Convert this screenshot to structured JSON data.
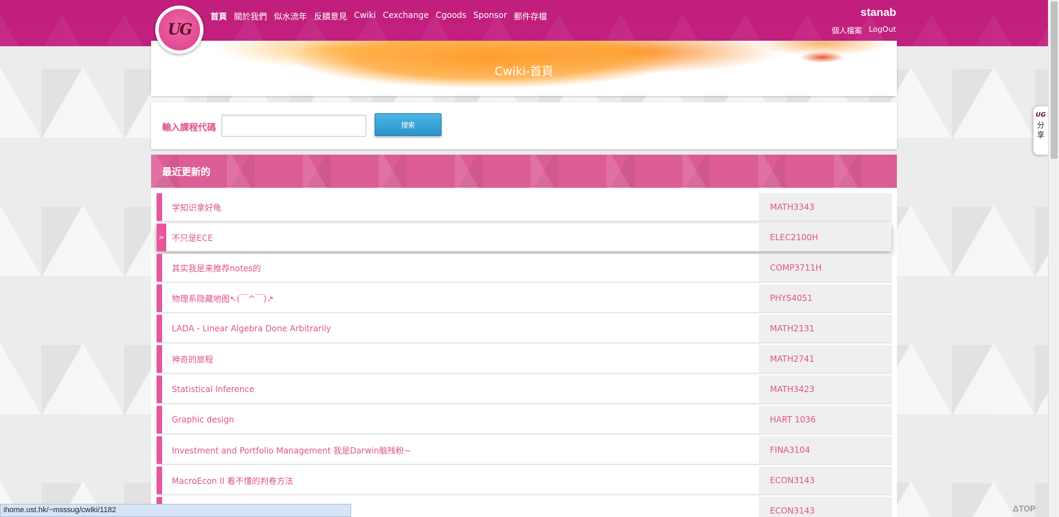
{
  "nav": {
    "items": [
      {
        "label": "首頁",
        "active": true
      },
      {
        "label": "關於我們"
      },
      {
        "label": "似水流年"
      },
      {
        "label": "反饋意見"
      },
      {
        "label": "Cwiki"
      },
      {
        "label": "Cexchange"
      },
      {
        "label": "Cgoods"
      },
      {
        "label": "Sponsor"
      },
      {
        "label": "郵件存檔"
      }
    ]
  },
  "logo": {
    "text": "UG"
  },
  "user": {
    "name": "stanab",
    "profile_label": "個人檔案",
    "logout_label": "LogOut"
  },
  "banner": {
    "title": "Cwiki-首頁"
  },
  "search": {
    "label": "輸入課程代碼",
    "value": "",
    "button_label": "搜索"
  },
  "recent": {
    "title": "最近更新的",
    "items": [
      {
        "title": "学知识拿好龟",
        "code": "MATH3343"
      },
      {
        "title": "不只是ECE",
        "code": "ELEC2100H",
        "hover": true
      },
      {
        "title": "其实我是来推荐notes的",
        "code": "COMP3711H"
      },
      {
        "title": "物理系隐藏地图↖(￣^￣)↗",
        "code": "PHYS4051"
      },
      {
        "title": "LADA - Linear Algebra Done Arbitrarily",
        "code": "MATH2131"
      },
      {
        "title": "神奇的旅程",
        "code": "MATH2741"
      },
      {
        "title": "Statistical Inference",
        "code": "MATH3423"
      },
      {
        "title": "Graphic design",
        "code": "HART 1036"
      },
      {
        "title": "Investment and Portfolio Management 我是Darwin脑残粉~",
        "code": "FINA3104"
      },
      {
        "title": "MacroEcon II 看不懂的判卷方法",
        "code": "ECON3143"
      },
      {
        "title": "",
        "code": "ECON3143"
      }
    ],
    "hover_marker": ">"
  },
  "share": {
    "logo": "UG",
    "label": "分享"
  },
  "status_bar": {
    "url": "ihome.ust.hk/~msssug/cwiki/1182"
  },
  "top_button": {
    "label": "ΔTOP"
  },
  "colors": {
    "topbar": "#c11d7d",
    "accent": "#e0528f",
    "header_band": "#dc5d95",
    "search_button": "#2a93c9"
  }
}
